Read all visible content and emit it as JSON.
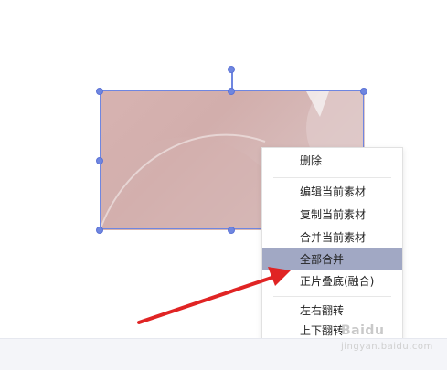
{
  "context_menu": {
    "items": [
      {
        "label": "删除"
      },
      {
        "label": "编辑当前素材"
      },
      {
        "label": "复制当前素材"
      },
      {
        "label": "合并当前素材"
      },
      {
        "label": "全部合并"
      },
      {
        "label": "正片叠底(融合)"
      },
      {
        "label": "左右翻转"
      },
      {
        "label": "上下翻转"
      }
    ],
    "highlighted": "全部合并"
  },
  "watermark": {
    "text": "Baidu",
    "suffix": "jingyan.baidu.com"
  },
  "colors": {
    "selection": "#6f86e0",
    "highlight": "#a1a8c4",
    "arrow": "#e02424"
  },
  "icons": [
    "rotate-handle-icon",
    "red-arrow-annotation"
  ]
}
